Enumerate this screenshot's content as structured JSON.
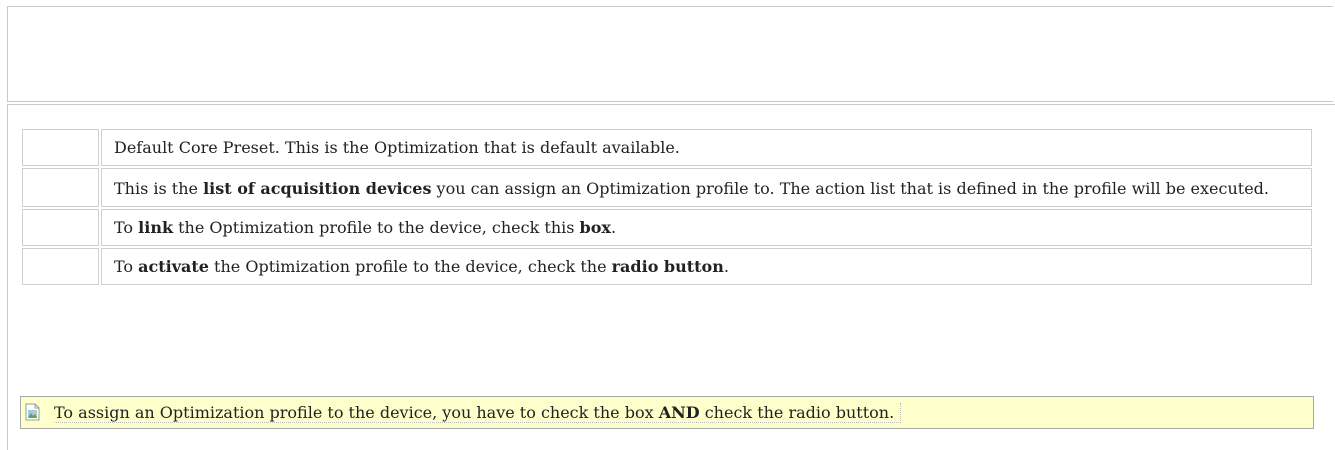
{
  "rows": [
    {
      "parts": [
        "Default Core Preset. This is the Optimization that is default available."
      ]
    },
    {
      "parts": [
        "This is the ",
        "list of acquisition devices",
        " you can assign an Optimization profile to. The action list that is defined in the profile will be executed."
      ]
    },
    {
      "parts": [
        "To ",
        "link",
        " the Optimization profile to the device, check this ",
        "box",
        "."
      ]
    },
    {
      "parts": [
        "To ",
        "activate",
        " the Optimization profile to the device, check the ",
        "radio button",
        "."
      ]
    }
  ],
  "note": {
    "icon": "broken-image-icon",
    "parts": [
      "To assign an Optimization profile to the device, you have to check the box ",
      "AND",
      " check the radio button."
    ]
  }
}
